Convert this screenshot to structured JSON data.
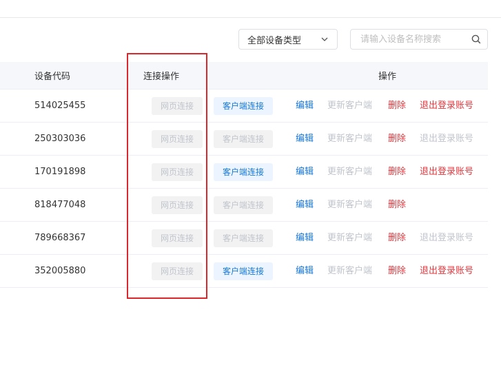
{
  "filters": {
    "type_select_value": "全部设备类型",
    "search_placeholder": "请输入设备名称搜索"
  },
  "table": {
    "headers": {
      "code": "设备代码",
      "connect": "连接操作",
      "actions": "操作"
    },
    "rows": [
      {
        "code": "514025455",
        "web": "网页连接",
        "client": "客户端连接",
        "client_enabled": true,
        "edit": "编辑",
        "update": "更新客户端",
        "delete": "删除",
        "logout": "退出登录账号",
        "logout_enabled": true
      },
      {
        "code": "250303036",
        "web": "网页连接",
        "client": "客户端连接",
        "client_enabled": false,
        "edit": "编辑",
        "update": "更新客户端",
        "delete": "删除",
        "logout": "退出登录账号",
        "logout_enabled": false
      },
      {
        "code": "170191898",
        "web": "网页连接",
        "client": "客户端连接",
        "client_enabled": true,
        "edit": "编辑",
        "update": "更新客户端",
        "delete": "删除",
        "logout": "退出登录账号",
        "logout_enabled": true
      },
      {
        "code": "818477048",
        "web": "网页连接",
        "client": "客户端连接",
        "client_enabled": false,
        "edit": "编辑",
        "update": "更新客户端",
        "delete": "删除",
        "logout": "",
        "logout_enabled": false
      },
      {
        "code": "789668367",
        "web": "网页连接",
        "client": "客户端连接",
        "client_enabled": false,
        "edit": "编辑",
        "update": "更新客户端",
        "delete": "删除",
        "logout": "退出登录账号",
        "logout_enabled": false
      },
      {
        "code": "352005880",
        "web": "网页连接",
        "client": "客户端连接",
        "client_enabled": true,
        "edit": "编辑",
        "update": "更新客户端",
        "delete": "删除",
        "logout": "退出登录账号",
        "logout_enabled": true
      }
    ]
  },
  "colors": {
    "link_blue": "#1677d9",
    "danger_red": "#e0383e",
    "disabled_gray": "#c0c4cc",
    "highlight_red": "#d9272e"
  }
}
